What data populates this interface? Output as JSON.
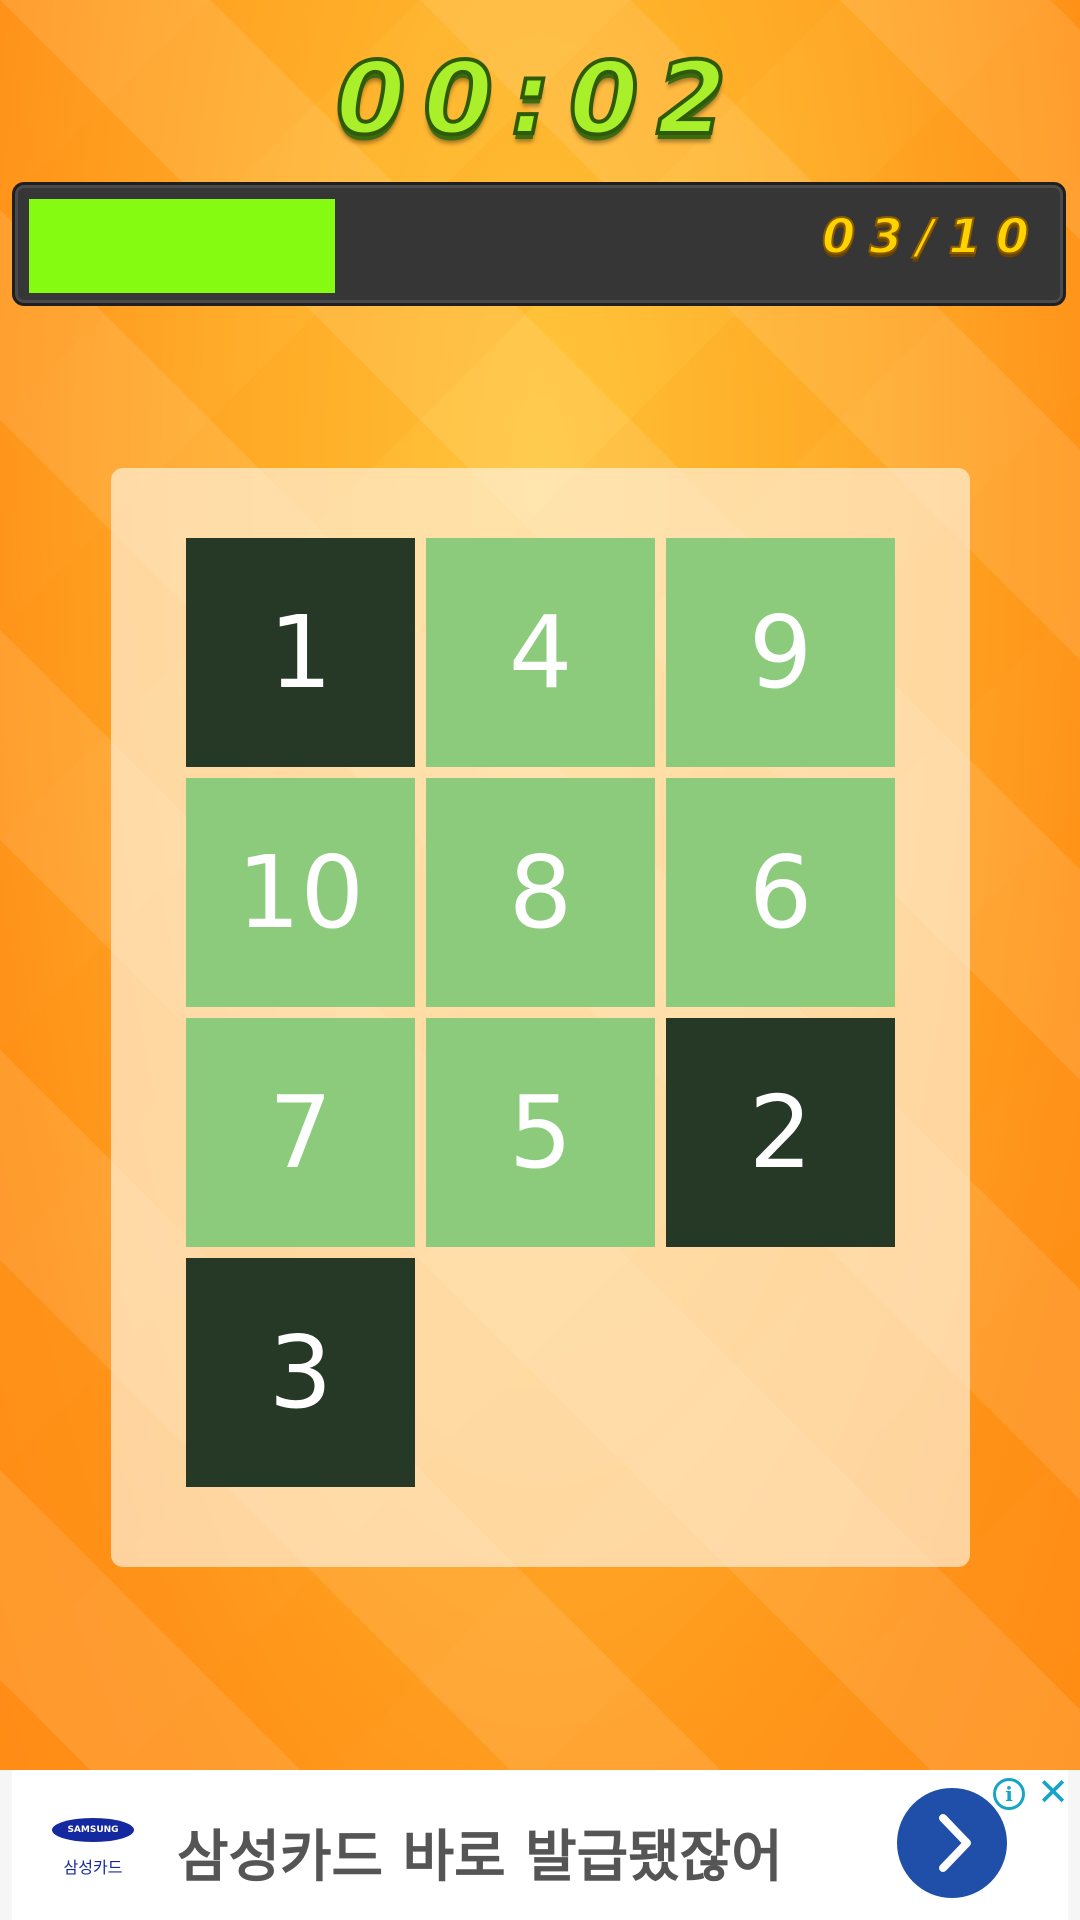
{
  "timer": {
    "text": "00:02"
  },
  "progress": {
    "text": "03/10",
    "fraction": 0.3
  },
  "tiles": [
    {
      "label": "1",
      "state": "done"
    },
    {
      "label": "4",
      "state": "todo"
    },
    {
      "label": "9",
      "state": "todo"
    },
    {
      "label": "10",
      "state": "todo"
    },
    {
      "label": "8",
      "state": "todo"
    },
    {
      "label": "6",
      "state": "todo"
    },
    {
      "label": "7",
      "state": "todo"
    },
    {
      "label": "5",
      "state": "todo"
    },
    {
      "label": "2",
      "state": "done"
    },
    {
      "label": "3",
      "state": "done"
    }
  ],
  "ad": {
    "brand_logo": "SAMSUNG",
    "brand_sub": "삼성카드",
    "text": "삼성카드 바로 발급됐잖어",
    "info_icon": "i",
    "close_icon": "✕",
    "arrow_icon": "chevron-right-icon"
  },
  "colors": {
    "tile_done": "#263826",
    "tile_todo": "#8bcb7b",
    "progress_fill": "#86fb12",
    "ad_arrow": "#1f4fa8"
  }
}
